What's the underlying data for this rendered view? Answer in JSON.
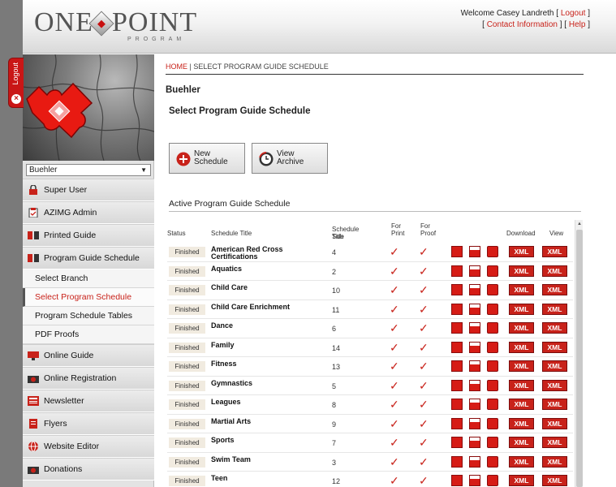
{
  "header": {
    "logo_word1": "ONE",
    "logo_word2": "POINT",
    "logo_sub": "PROGRAM",
    "welcome_prefix": "Welcome Casey Landreth [ ",
    "logout_link": "Logout",
    "welcome_suffix": " ]",
    "bracket_open": "[ ",
    "contact_link": "Contact Information",
    "separator": " ] [ ",
    "help_link": "Help",
    "bracket_close": " ]"
  },
  "logout_tab": {
    "label": "Logout",
    "icon": "close-icon"
  },
  "sidebar": {
    "branch_select": "Buehler",
    "menu": [
      {
        "label": "Super User",
        "icon": "lock-icon"
      },
      {
        "label": "AZIMG Admin",
        "icon": "clipboard-icon"
      },
      {
        "label": "Printed Guide",
        "icon": "book-icon"
      },
      {
        "label": "Program Guide Schedule",
        "icon": "book-icon"
      }
    ],
    "submenu": [
      {
        "label": "Select Branch"
      },
      {
        "label": "Select Program Schedule"
      },
      {
        "label": "Program Schedule Tables"
      },
      {
        "label": "PDF Proofs"
      }
    ],
    "menu2": [
      {
        "label": "Online Guide",
        "icon": "monitor-icon"
      },
      {
        "label": "Online Registration",
        "icon": "camera-icon"
      },
      {
        "label": "Newsletter",
        "icon": "newspaper-icon"
      },
      {
        "label": "Flyers",
        "icon": "document-icon"
      },
      {
        "label": "Website Editor",
        "icon": "globe-icon"
      },
      {
        "label": "Donations",
        "icon": "camera-icon"
      }
    ]
  },
  "breadcrumb": {
    "home": "HOME",
    "separator": " | ",
    "current": "SELECT PROGRAM GUIDE SCHEDULE"
  },
  "branch_name": "Buehler",
  "page_title": "Select Program Guide Schedule",
  "buttons": {
    "new_line1": "New",
    "new_line2": "Schedule",
    "archive_line1": "View",
    "archive_line2": "Archive"
  },
  "section_label": "Active Program Guide Schedule",
  "table": {
    "headers": {
      "status": "Status",
      "title": "Schedule Title",
      "sub1": "Schedule Sub",
      "sub2": "Title",
      "print1": "For",
      "print2": "Print",
      "proof1": "For",
      "proof2": "Proof",
      "download": "Download",
      "view": "View"
    },
    "xml_label": "XML",
    "check_glyph": "✓",
    "rows": [
      {
        "status": "Finished",
        "title": "American Red Cross Certifications",
        "sub": "4"
      },
      {
        "status": "Finished",
        "title": "Aquatics",
        "sub": "2"
      },
      {
        "status": "Finished",
        "title": "Child Care",
        "sub": "10"
      },
      {
        "status": "Finished",
        "title": "Child Care Enrichment",
        "sub": "11"
      },
      {
        "status": "Finished",
        "title": "Dance",
        "sub": "6"
      },
      {
        "status": "Finished",
        "title": "Family",
        "sub": "14"
      },
      {
        "status": "Finished",
        "title": "Fitness",
        "sub": "13"
      },
      {
        "status": "Finished",
        "title": "Gymnastics",
        "sub": "5"
      },
      {
        "status": "Finished",
        "title": "Leagues",
        "sub": "8"
      },
      {
        "status": "Finished",
        "title": "Martial Arts",
        "sub": "9"
      },
      {
        "status": "Finished",
        "title": "Sports",
        "sub": "7"
      },
      {
        "status": "Finished",
        "title": "Swim Team",
        "sub": "3"
      },
      {
        "status": "Finished",
        "title": "Teen",
        "sub": "12"
      }
    ]
  },
  "colors": {
    "accent": "#c8221a",
    "sidebar_bg": "#e3e3e3",
    "page_bg": "#7a7a7a"
  }
}
